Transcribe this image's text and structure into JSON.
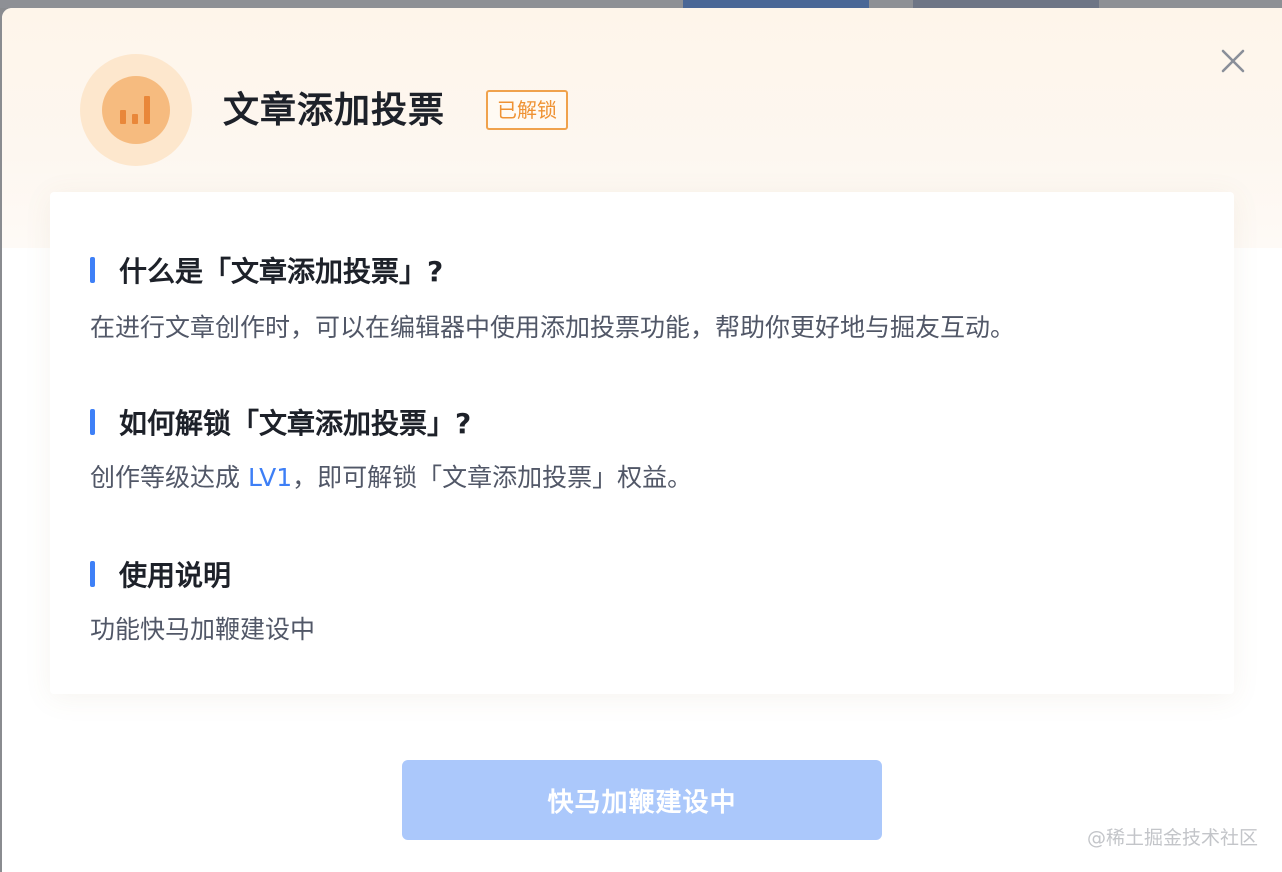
{
  "dialog": {
    "title": "文章添加投票",
    "badge": "已解锁",
    "icon": "bar-chart-icon",
    "close_icon": "close-icon"
  },
  "sections": [
    {
      "heading": "什么是「文章添加投票」?",
      "text": "在进行文章创作时，可以在编辑器中使用添加投票功能，帮助你更好地与掘友互动。"
    },
    {
      "heading": "如何解锁「文章添加投票」?",
      "text_before": "创作等级达成 ",
      "link": "LV1",
      "text_after": "，即可解锁「文章添加投票」权益。"
    },
    {
      "heading": "使用说明",
      "text": "功能快马加鞭建设中"
    }
  ],
  "action_button": {
    "label": "快马加鞭建设中",
    "disabled": true
  },
  "watermark": "@稀土掘金技术社区",
  "colors": {
    "accent": "#3e80f7",
    "badge": "#ef9233",
    "icon_orange": "#e9873a",
    "button_disabled": "#abc8fb"
  }
}
